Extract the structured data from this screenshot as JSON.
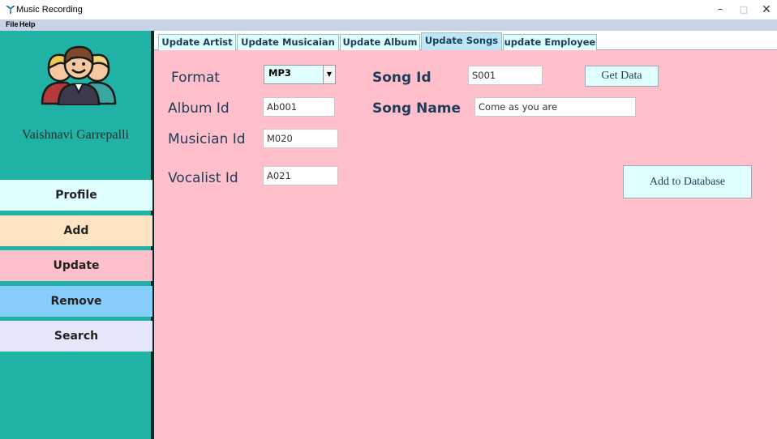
{
  "window": {
    "title": "Music Recording",
    "controls": {
      "minimize": "–",
      "maximize": "□",
      "close": "✕"
    }
  },
  "menu": {
    "file": "File",
    "help": "Help"
  },
  "sidebar": {
    "user_name": "Vaishnavi Garrepalli",
    "items": [
      {
        "label": "Profile",
        "color": "#e0ffff"
      },
      {
        "label": "Add",
        "color": "#ffe4c4"
      },
      {
        "label": "Update",
        "color": "#ffc0cb"
      },
      {
        "label": "Remove",
        "color": "#87cefa"
      },
      {
        "label": "Search",
        "color": "#e6e6fa"
      }
    ]
  },
  "tabs": [
    {
      "label": "Update  Artist"
    },
    {
      "label": "Update Musicaian"
    },
    {
      "label": "Update Album"
    },
    {
      "label": "Update Songs",
      "selected": true
    },
    {
      "label": "update Employee"
    }
  ],
  "form": {
    "format_label": "Format",
    "format_value": "MP3",
    "album_id_label": "Album Id",
    "album_id_value": "Ab001",
    "musician_id_label": "Musician Id",
    "musician_id_value": "M020",
    "vocalist_id_label": "Vocalist Id",
    "vocalist_id_value": "A021",
    "song_id_label": "Song Id",
    "song_id_value": "S001",
    "song_name_label": "Song Name",
    "song_name_value": "Come as you are",
    "get_data_label": "Get Data",
    "add_label": "Add to Database"
  },
  "colors": {
    "sidebar": "#20b2a5",
    "panel": "#ffc0cb",
    "menubar": "#c9d3e6",
    "label_text": "#1f3b5a"
  }
}
